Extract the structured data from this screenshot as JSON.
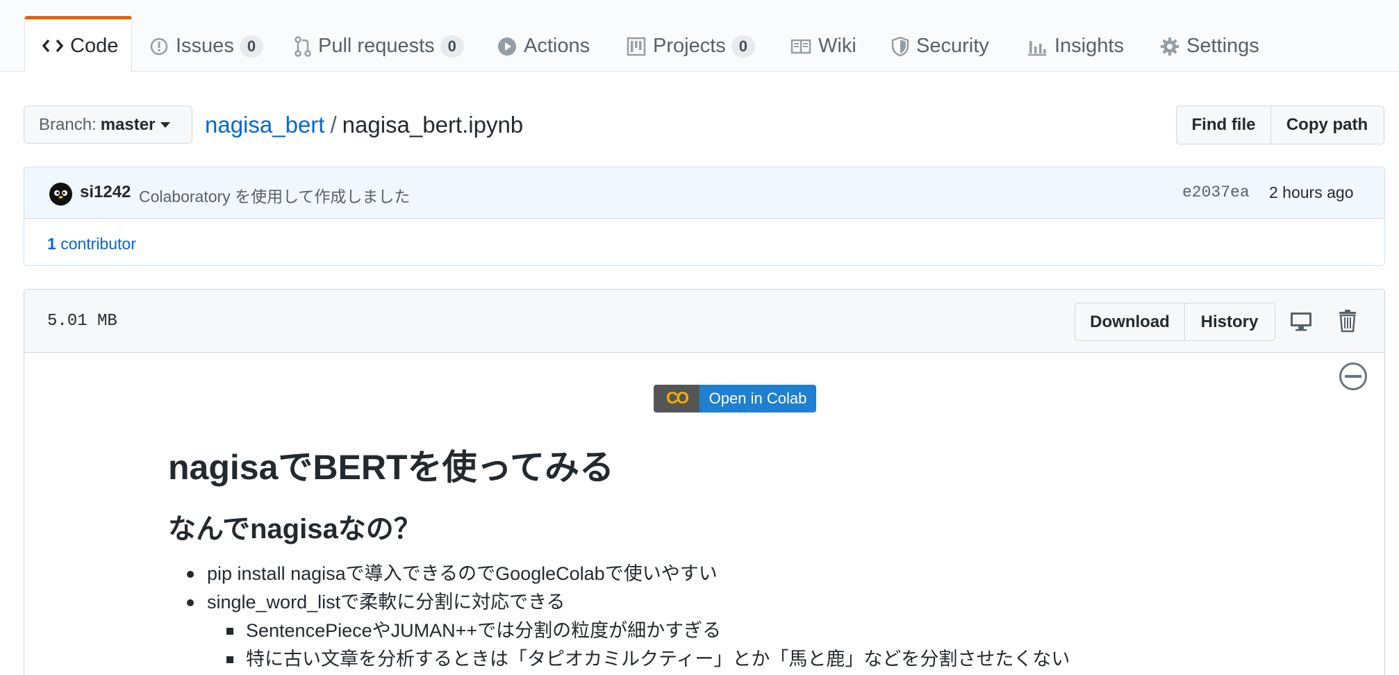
{
  "tabs": [
    {
      "label": "Code",
      "icon": "code-icon",
      "selected": true
    },
    {
      "label": "Issues",
      "count": "0",
      "icon": "issue-icon"
    },
    {
      "label": "Pull requests",
      "count": "0",
      "icon": "pull-request-icon"
    },
    {
      "label": "Actions",
      "icon": "play-icon"
    },
    {
      "label": "Projects",
      "count": "0",
      "icon": "project-icon"
    },
    {
      "label": "Wiki",
      "icon": "book-icon"
    },
    {
      "label": "Security",
      "icon": "shield-icon"
    },
    {
      "label": "Insights",
      "icon": "graph-icon"
    },
    {
      "label": "Settings",
      "icon": "gear-icon"
    }
  ],
  "branch": {
    "prefix": "Branch:",
    "name": "master"
  },
  "breadcrumb": {
    "repo": "nagisa_bert",
    "separator": "/",
    "file": "nagisa_bert.ipynb"
  },
  "file_actions": {
    "find_file": "Find file",
    "copy_path": "Copy path"
  },
  "commit": {
    "author": "si1242",
    "message": "Colaboratory を使用して作成しました",
    "sha": "e2037ea",
    "time": "2 hours ago",
    "contributors_count": "1",
    "contributors_label": "contributor"
  },
  "file": {
    "size": "5.01 MB",
    "download": "Download",
    "history": "History"
  },
  "notebook": {
    "colab_logo": "CO",
    "colab_label": "Open in Colab",
    "h1": "nagisaでBERTを使ってみる",
    "h2": "なんでnagisaなの？",
    "bullets": [
      "pip install nagisaで導入できるのでGoogleColabで使いやすい",
      "single_word_listで柔軟に分割に対応できる"
    ],
    "sub_bullets": [
      "SentencePieceやJUMAN++では分割の粒度が細かすぎる",
      "特に古い文章を分析するときは「タピオカミルクティー」とか「馬と鹿」などを分割させたくない"
    ]
  },
  "colors": {
    "accent": "#e36209",
    "link": "#0366d6",
    "colab_blue": "#1f7fd1",
    "colab_orange": "#f9ab00"
  }
}
